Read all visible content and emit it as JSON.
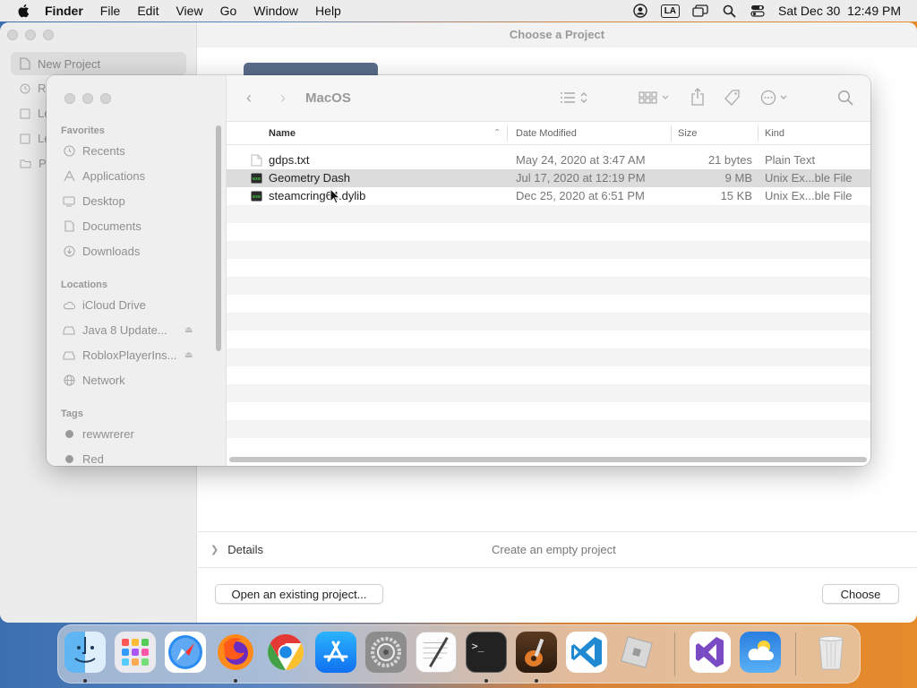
{
  "menubar": {
    "app": "Finder",
    "items": [
      "File",
      "Edit",
      "View",
      "Go",
      "Window",
      "Help"
    ],
    "input_source": "LA",
    "clock": "Sat Dec 30  12:49 PM"
  },
  "back_window": {
    "title": "Choose a Project",
    "sidebar": {
      "selected": "New Project",
      "items": [
        "Re",
        "Le",
        "Le",
        "Pr"
      ]
    },
    "details_label": "Details",
    "details_desc": "Create an empty project",
    "open_button": "Open an existing project...",
    "choose_button": "Choose"
  },
  "panel": {
    "location": "MacOS",
    "sidebar": {
      "favorites_header": "Favorites",
      "favorites": [
        {
          "label": "Recents",
          "icon": "clock-icon"
        },
        {
          "label": "Applications",
          "icon": "applications-icon"
        },
        {
          "label": "Desktop",
          "icon": "desktop-icon"
        },
        {
          "label": "Documents",
          "icon": "document-icon"
        },
        {
          "label": "Downloads",
          "icon": "download-icon"
        }
      ],
      "locations_header": "Locations",
      "locations": [
        {
          "label": "iCloud Drive",
          "icon": "cloud-icon"
        },
        {
          "label": "Java 8 Update...",
          "icon": "drive-icon"
        },
        {
          "label": "RobloxPlayerIns...",
          "icon": "drive-icon"
        },
        {
          "label": "Network",
          "icon": "globe-icon"
        }
      ],
      "tags_header": "Tags",
      "tags": [
        "rewwrerer",
        "Red"
      ]
    },
    "columns": {
      "name": "Name",
      "date": "Date Modified",
      "size": "Size",
      "kind": "Kind"
    },
    "files": [
      {
        "name": "gdps.txt",
        "date": "May 24, 2020 at 3:47 AM",
        "size": "21 bytes",
        "kind": "Plain Text",
        "icon": "text-file-icon"
      },
      {
        "name": "Geometry Dash",
        "date": "Jul 17, 2020 at 12:19 PM",
        "size": "9 MB",
        "kind": "Unix Ex...ble File",
        "icon": "executable-icon"
      },
      {
        "name": "steamcring64.dylib",
        "date": "Dec 25, 2020 at 6:51 PM",
        "size": "15 KB",
        "kind": "Unix Ex...ble File",
        "icon": "executable-icon"
      }
    ],
    "selected_row": 1
  },
  "dock": {
    "apps": [
      "Finder",
      "Launchpad",
      "Safari",
      "Firefox",
      "Chrome",
      "App Store",
      "System Preferences",
      "TextEdit",
      "Terminal",
      "GarageBand",
      "Visual Studio Code",
      "Roblox",
      "Visual Studio",
      "Weather",
      "Trash"
    ]
  },
  "colors": {
    "selection": "#dcdcdc",
    "sidebar_bg": "#efefef",
    "wallpaper_left": "#3b6fb0",
    "wallpaper_right": "#e58b2c"
  }
}
